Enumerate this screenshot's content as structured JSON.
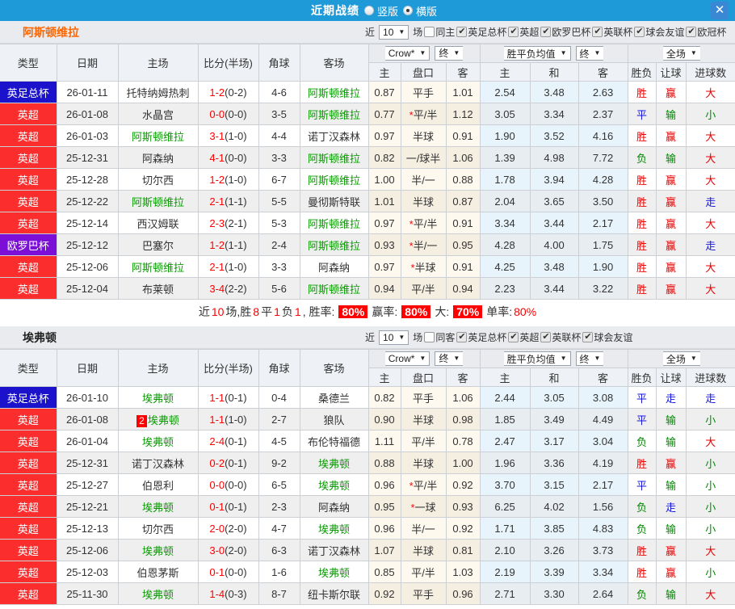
{
  "window": {
    "title": "近期战绩",
    "view_options": [
      {
        "label": "竖版",
        "selected": false
      },
      {
        "label": "横版",
        "selected": true
      }
    ],
    "close_icon": "✕",
    "bar_color": "#1e9ad8"
  },
  "type_colors": {
    "英足总杯": "#1a13cb",
    "英超": "#fc2d2d",
    "欧罗巴杯": "#7b0fd6"
  },
  "outcome_colors": {
    "胜": "#e60000",
    "赢": "#e60000",
    "大": "#e60000",
    "平": "#1414e0",
    "走": "#1414e0",
    "负": "#008800",
    "输": "#008800",
    "小": "#008800"
  },
  "sections": [
    {
      "team": "阿斯顿维拉",
      "team_color": "#ff6600",
      "filters": {
        "near": "近",
        "count": "10",
        "unit": "场",
        "same": {
          "label": "同主",
          "checked": false
        },
        "competitions": [
          {
            "label": "英足总杯",
            "checked": true
          },
          {
            "label": "英超",
            "checked": true
          },
          {
            "label": "欧罗巴杯",
            "checked": true
          },
          {
            "label": "英联杯",
            "checked": true
          },
          {
            "label": "球会友谊",
            "checked": true
          },
          {
            "label": "欧冠杯",
            "checked": true
          }
        ]
      },
      "header": {
        "col_type": "类型",
        "col_date": "日期",
        "col_home": "主场",
        "col_score": "比分(半场)",
        "col_corner": "角球",
        "col_away": "客场",
        "dd_odds": "Crow*",
        "dd_odds_final": "终",
        "dd_avg": "胜平负均值",
        "dd_avg_final": "终",
        "dd_scope": "全场",
        "sub": [
          "主",
          "盘口",
          "客",
          "主",
          "和",
          "客",
          "胜负",
          "让球",
          "进球数"
        ]
      },
      "rows": [
        {
          "type": "英足总杯",
          "date": "26-01-11",
          "home": "托特纳姆热刺",
          "away": "阿斯顿维拉",
          "score": "1-2",
          "half": "(0-2)",
          "corner": "4-6",
          "odds": [
            "0.87",
            "平手",
            "1.01"
          ],
          "avg": [
            "2.54",
            "3.48",
            "2.63"
          ],
          "results": [
            "胜",
            "赢",
            "大"
          ]
        },
        {
          "type": "英超",
          "date": "26-01-08",
          "home": "水晶宫",
          "away": "阿斯顿维拉",
          "score": "0-0",
          "half": "(0-0)",
          "corner": "3-5",
          "odds": [
            "0.77",
            "*平/半",
            "1.12"
          ],
          "avg": [
            "3.05",
            "3.34",
            "2.37"
          ],
          "results": [
            "平",
            "输",
            "小"
          ]
        },
        {
          "type": "英超",
          "date": "26-01-03",
          "home": "阿斯顿维拉",
          "away": "诺丁汉森林",
          "score": "3-1",
          "half": "(1-0)",
          "corner": "4-4",
          "odds": [
            "0.97",
            "半球",
            "0.91"
          ],
          "avg": [
            "1.90",
            "3.52",
            "4.16"
          ],
          "results": [
            "胜",
            "赢",
            "大"
          ]
        },
        {
          "type": "英超",
          "date": "25-12-31",
          "home": "阿森纳",
          "away": "阿斯顿维拉",
          "score": "4-1",
          "half": "(0-0)",
          "corner": "3-3",
          "odds": [
            "0.82",
            "一/球半",
            "1.06"
          ],
          "avg": [
            "1.39",
            "4.98",
            "7.72"
          ],
          "results": [
            "负",
            "输",
            "大"
          ]
        },
        {
          "type": "英超",
          "date": "25-12-28",
          "home": "切尔西",
          "away": "阿斯顿维拉",
          "score": "1-2",
          "half": "(1-0)",
          "corner": "6-7",
          "odds": [
            "1.00",
            "半/一",
            "0.88"
          ],
          "avg": [
            "1.78",
            "3.94",
            "4.28"
          ],
          "results": [
            "胜",
            "赢",
            "大"
          ]
        },
        {
          "type": "英超",
          "date": "25-12-22",
          "home": "阿斯顿维拉",
          "away": "曼彻斯特联",
          "score": "2-1",
          "half": "(1-1)",
          "corner": "5-5",
          "odds": [
            "1.01",
            "半球",
            "0.87"
          ],
          "avg": [
            "2.04",
            "3.65",
            "3.50"
          ],
          "results": [
            "胜",
            "赢",
            "走"
          ]
        },
        {
          "type": "英超",
          "date": "25-12-14",
          "home": "西汉姆联",
          "away": "阿斯顿维拉",
          "score": "2-3",
          "half": "(2-1)",
          "corner": "5-3",
          "odds": [
            "0.97",
            "*平/半",
            "0.91"
          ],
          "avg": [
            "3.34",
            "3.44",
            "2.17"
          ],
          "results": [
            "胜",
            "赢",
            "大"
          ]
        },
        {
          "type": "欧罗巴杯",
          "date": "25-12-12",
          "home": "巴塞尔",
          "away": "阿斯顿维拉",
          "score": "1-2",
          "half": "(1-1)",
          "corner": "2-4",
          "odds": [
            "0.93",
            "*半/一",
            "0.95"
          ],
          "avg": [
            "4.28",
            "4.00",
            "1.75"
          ],
          "results": [
            "胜",
            "赢",
            "走"
          ]
        },
        {
          "type": "英超",
          "date": "25-12-06",
          "home": "阿斯顿维拉",
          "away": "阿森纳",
          "score": "2-1",
          "half": "(1-0)",
          "corner": "3-3",
          "odds": [
            "0.97",
            "*半球",
            "0.91"
          ],
          "avg": [
            "4.25",
            "3.48",
            "1.90"
          ],
          "results": [
            "胜",
            "赢",
            "大"
          ]
        },
        {
          "type": "英超",
          "date": "25-12-04",
          "home": "布莱顿",
          "away": "阿斯顿维拉",
          "score": "3-4",
          "half": "(2-2)",
          "corner": "5-6",
          "odds": [
            "0.94",
            "平/半",
            "0.94"
          ],
          "avg": [
            "2.23",
            "3.44",
            "3.22"
          ],
          "results": [
            "胜",
            "赢",
            "大"
          ]
        }
      ],
      "summary": {
        "segments": [
          {
            "text": "近"
          },
          {
            "text": "10",
            "style": "red-text"
          },
          {
            "text": "场,胜"
          },
          {
            "text": "8",
            "style": "red-text"
          },
          {
            "text": "平"
          },
          {
            "text": "1",
            "style": "red-text"
          },
          {
            "text": "负"
          },
          {
            "text": "1",
            "style": "red-text"
          },
          {
            "text": ", 胜率:"
          },
          {
            "text": "80%",
            "style": "red-badge"
          },
          {
            "text": "赢率:"
          },
          {
            "text": "80%",
            "style": "red-badge"
          },
          {
            "text": "大:"
          },
          {
            "text": "70%",
            "style": "red-badge"
          },
          {
            "text": "单率:"
          },
          {
            "text": "80%",
            "style": "red-text"
          }
        ]
      }
    },
    {
      "team": "埃弗顿",
      "team_color": "#222222",
      "filters": {
        "near": "近",
        "count": "10",
        "unit": "场",
        "same": {
          "label": "同客",
          "checked": false
        },
        "competitions": [
          {
            "label": "英足总杯",
            "checked": true
          },
          {
            "label": "英超",
            "checked": true
          },
          {
            "label": "英联杯",
            "checked": true
          },
          {
            "label": "球会友谊",
            "checked": true
          }
        ]
      },
      "header": {
        "col_type": "类型",
        "col_date": "日期",
        "col_home": "主场",
        "col_score": "比分(半场)",
        "col_corner": "角球",
        "col_away": "客场",
        "dd_odds": "Crow*",
        "dd_odds_final": "终",
        "dd_avg": "胜平负均值",
        "dd_avg_final": "终",
        "dd_scope": "全场",
        "sub": [
          "主",
          "盘口",
          "客",
          "主",
          "和",
          "客",
          "胜负",
          "让球",
          "进球数"
        ]
      },
      "rows": [
        {
          "type": "英足总杯",
          "date": "26-01-10",
          "home": "埃弗顿",
          "away": "桑德兰",
          "score": "1-1",
          "half": "(0-1)",
          "corner": "0-4",
          "odds": [
            "0.82",
            "平手",
            "1.06"
          ],
          "avg": [
            "2.44",
            "3.05",
            "3.08"
          ],
          "results": [
            "平",
            "走",
            "走"
          ]
        },
        {
          "type": "英超",
          "date": "26-01-08",
          "home": "埃弗顿",
          "home_badge": "2",
          "away": "狼队",
          "score": "1-1",
          "half": "(1-0)",
          "corner": "2-7",
          "odds": [
            "0.90",
            "半球",
            "0.98"
          ],
          "avg": [
            "1.85",
            "3.49",
            "4.49"
          ],
          "results": [
            "平",
            "输",
            "小"
          ]
        },
        {
          "type": "英超",
          "date": "26-01-04",
          "home": "埃弗顿",
          "away": "布伦特福德",
          "score": "2-4",
          "half": "(0-1)",
          "corner": "4-5",
          "odds": [
            "1.11",
            "平/半",
            "0.78"
          ],
          "avg": [
            "2.47",
            "3.17",
            "3.04"
          ],
          "results": [
            "负",
            "输",
            "大"
          ]
        },
        {
          "type": "英超",
          "date": "25-12-31",
          "home": "诺丁汉森林",
          "away": "埃弗顿",
          "score": "0-2",
          "half": "(0-1)",
          "corner": "9-2",
          "odds": [
            "0.88",
            "半球",
            "1.00"
          ],
          "avg": [
            "1.96",
            "3.36",
            "4.19"
          ],
          "results": [
            "胜",
            "赢",
            "小"
          ]
        },
        {
          "type": "英超",
          "date": "25-12-27",
          "home": "伯恩利",
          "away": "埃弗顿",
          "score": "0-0",
          "half": "(0-0)",
          "corner": "6-5",
          "odds": [
            "0.96",
            "*平/半",
            "0.92"
          ],
          "avg": [
            "3.70",
            "3.15",
            "2.17"
          ],
          "results": [
            "平",
            "输",
            "小"
          ]
        },
        {
          "type": "英超",
          "date": "25-12-21",
          "home": "埃弗顿",
          "away": "阿森纳",
          "score": "0-1",
          "half": "(0-1)",
          "corner": "2-3",
          "odds": [
            "0.95",
            "*一球",
            "0.93"
          ],
          "avg": [
            "6.25",
            "4.02",
            "1.56"
          ],
          "results": [
            "负",
            "走",
            "小"
          ]
        },
        {
          "type": "英超",
          "date": "25-12-13",
          "home": "切尔西",
          "away": "埃弗顿",
          "score": "2-0",
          "half": "(2-0)",
          "corner": "4-7",
          "odds": [
            "0.96",
            "半/一",
            "0.92"
          ],
          "avg": [
            "1.71",
            "3.85",
            "4.83"
          ],
          "results": [
            "负",
            "输",
            "小"
          ]
        },
        {
          "type": "英超",
          "date": "25-12-06",
          "home": "埃弗顿",
          "away": "诺丁汉森林",
          "score": "3-0",
          "half": "(2-0)",
          "corner": "6-3",
          "odds": [
            "1.07",
            "半球",
            "0.81"
          ],
          "avg": [
            "2.10",
            "3.26",
            "3.73"
          ],
          "results": [
            "胜",
            "赢",
            "大"
          ]
        },
        {
          "type": "英超",
          "date": "25-12-03",
          "home": "伯恩茅斯",
          "away": "埃弗顿",
          "score": "0-1",
          "half": "(0-0)",
          "corner": "1-6",
          "odds": [
            "0.85",
            "平/半",
            "1.03"
          ],
          "avg": [
            "2.19",
            "3.39",
            "3.34"
          ],
          "results": [
            "胜",
            "赢",
            "小"
          ]
        },
        {
          "type": "英超",
          "date": "25-11-30",
          "home": "埃弗顿",
          "away": "纽卡斯尔联",
          "score": "1-4",
          "half": "(0-3)",
          "corner": "8-7",
          "odds": [
            "0.92",
            "平手",
            "0.96"
          ],
          "avg": [
            "2.71",
            "3.30",
            "2.64"
          ],
          "results": [
            "负",
            "输",
            "大"
          ]
        }
      ]
    }
  ]
}
